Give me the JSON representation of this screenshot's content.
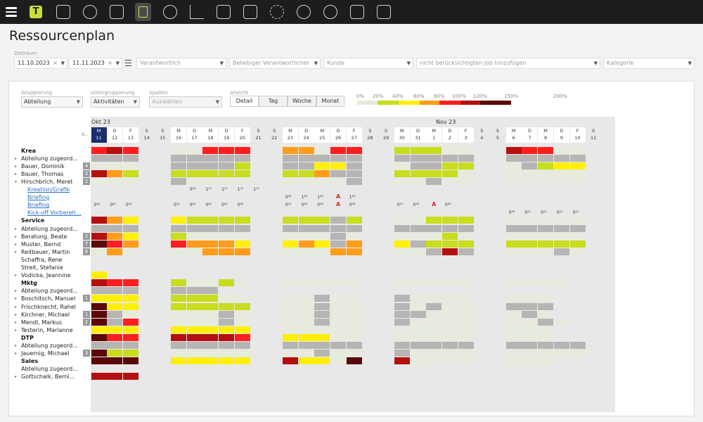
{
  "app": {
    "page_title": "Ressourcenplan"
  },
  "topbar": {
    "logo_letter": "T",
    "icons": [
      "menu-icon",
      "timesheet-icon",
      "location-icon",
      "files-icon",
      "plan-icon",
      "clock-icon",
      "chart-icon",
      "cart-icon",
      "documents-icon",
      "gear-icon",
      "sync-icon",
      "people-icon",
      "megaphone-icon",
      "chat-icon"
    ]
  },
  "filters": {
    "zeitraum_label": "Zeitraum",
    "from_date": "11.10.2023",
    "to_date": "11.11.2023",
    "verantwortlich": "Verantwortlich",
    "beliebiger": "Beliebiger Verantwortlicher",
    "kunde": "Kunde",
    "job": "nicht berücksichtigten Job hinzufügen",
    "kategorie": "Kategorie"
  },
  "controls": {
    "gruppierung_label": "Gruppierung",
    "gruppierung_value": "Abteilung",
    "untergruppierung_label": "Untergruppierung",
    "untergruppierung_value": "Aktivitäten",
    "spalten_label": "Spalten",
    "spalten_value": "Auswählen",
    "ansicht_label": "Ansicht",
    "views": [
      "Detail",
      "Tag",
      "Woche",
      "Monat"
    ],
    "active_view": "Detail"
  },
  "legend": {
    "labels": [
      "0%",
      "20%",
      "40%",
      "60%",
      "80%",
      "100%",
      "120%",
      "150%",
      "200%"
    ],
    "colors": [
      "#e6ebdd",
      "#c7dd1d",
      "#ffef00",
      "#ff9d19",
      "#ff1e1e",
      "#b51010",
      "#5a0808"
    ]
  },
  "colors": {
    "today": "#1c2e6e",
    "absence": "#e02020"
  },
  "calendar": {
    "months": [
      "Okt 23",
      "Nov 23"
    ],
    "axis_prefix": "A...",
    "days": [
      {
        "wd": "M",
        "d": "11"
      },
      {
        "wd": "D",
        "d": "12"
      },
      {
        "wd": "F",
        "d": "13"
      },
      {
        "wd": "S",
        "d": "14"
      },
      {
        "wd": "S",
        "d": "15"
      },
      {
        "wd": "M",
        "d": "16"
      },
      {
        "wd": "D",
        "d": "17"
      },
      {
        "wd": "M",
        "d": "18"
      },
      {
        "wd": "D",
        "d": "19"
      },
      {
        "wd": "F",
        "d": "20"
      },
      {
        "wd": "S",
        "d": "21"
      },
      {
        "wd": "S",
        "d": "22"
      },
      {
        "wd": "M",
        "d": "23"
      },
      {
        "wd": "D",
        "d": "24"
      },
      {
        "wd": "M",
        "d": "25"
      },
      {
        "wd": "D",
        "d": "26"
      },
      {
        "wd": "F",
        "d": "27"
      },
      {
        "wd": "S",
        "d": "28"
      },
      {
        "wd": "S",
        "d": "29"
      },
      {
        "wd": "M",
        "d": "30"
      },
      {
        "wd": "D",
        "d": "31"
      },
      {
        "wd": "M",
        "d": "1"
      },
      {
        "wd": "D",
        "d": "2"
      },
      {
        "wd": "F",
        "d": "3"
      },
      {
        "wd": "S",
        "d": "4"
      },
      {
        "wd": "S",
        "d": "5"
      },
      {
        "wd": "M",
        "d": "6"
      },
      {
        "wd": "D",
        "d": "7"
      },
      {
        "wd": "M",
        "d": "8"
      },
      {
        "wd": "D",
        "d": "9"
      },
      {
        "wd": "F",
        "d": "10"
      },
      {
        "wd": "S",
        "d": "11"
      }
    ]
  },
  "rows": [
    {
      "type": "group",
      "label": "Krea",
      "cells": "5656500555544405500222000665500222222"
    },
    {
      "type": "person",
      "label": "Abteilung zugeord...",
      "expand": "▸",
      "cells": "XXX00XXXXX00XXXXX00XXXXX00XXXXX0"
    },
    {
      "type": "person",
      "label": "Bauer, Dominik",
      "badge": "4",
      "expand": "▸",
      "cells": "00000XXXX200XX33X200XX22200X2332"
    },
    {
      "type": "person",
      "label": "Bauer, Thomas",
      "badge": "2",
      "expand": "▸",
      "cells": "642002222200224XX00222200000000"
    },
    {
      "type": "person",
      "label": "Hirschbrich, Meret",
      "badge": "2",
      "expand": "▾",
      "cells": "11100X1111001111X1001X11110011111"
    },
    {
      "type": "task",
      "label": "Kreation/Grafik",
      "loads": [
        [
          6,
          "0⁵³"
        ],
        [
          7,
          "1⁴⁷"
        ],
        [
          8,
          "1⁴⁷"
        ],
        [
          9,
          "1⁴⁷"
        ],
        [
          10,
          "1⁴⁷"
        ]
      ]
    },
    {
      "type": "task",
      "label": "Briefing",
      "loads": [
        [
          12,
          "0⁴³"
        ],
        [
          13,
          "1²⁵"
        ],
        [
          14,
          "1²⁵"
        ],
        [
          15,
          "A"
        ],
        [
          16,
          "1²⁵"
        ]
      ]
    },
    {
      "type": "task",
      "label": "Briefing",
      "loads": [
        [
          0,
          "0²²"
        ],
        [
          1,
          "0²²"
        ],
        [
          2,
          "0²²"
        ],
        [
          5,
          "0¹¹"
        ],
        [
          6,
          "0²²"
        ],
        [
          7,
          "0²²"
        ],
        [
          8,
          "0²²"
        ],
        [
          9,
          "0²²"
        ],
        [
          12,
          "0¹¹"
        ],
        [
          13,
          "0²²"
        ],
        [
          14,
          "0²²"
        ],
        [
          15,
          "A"
        ],
        [
          16,
          "0²²"
        ],
        [
          19,
          "0¹¹"
        ],
        [
          20,
          "0²²"
        ],
        [
          21,
          "A"
        ],
        [
          22,
          "0²²"
        ]
      ]
    },
    {
      "type": "task",
      "label": "Kick-off Vorbereit...",
      "loads": [
        [
          26,
          "0⁰⁶"
        ],
        [
          27,
          "0¹¹"
        ],
        [
          28,
          "0¹¹"
        ],
        [
          29,
          "0¹¹"
        ],
        [
          30,
          "0¹¹"
        ]
      ]
    },
    {
      "type": "group",
      "label": "Service",
      "cells": "643003222200222X2001122200000000"
    },
    {
      "type": "person",
      "label": "Abteilung zugeord...",
      "expand": "▸",
      "cells": "XXX00XXXXX00XXXXX00XXXXX00XXXXX0"
    },
    {
      "type": "person",
      "label": "Beratung, Beate",
      "badge": "2",
      "expand": "▸",
      "cells": "643002000000000X000000200000000"
    },
    {
      "type": "person",
      "label": "Muster, Bernd",
      "badge": "7",
      "expand": "▸",
      "cells": "754005444300343X4003X22200222222"
    },
    {
      "type": "person",
      "label": "Reitbauer, Martin",
      "badge": "6",
      "expand": "▸",
      "cells": "141000044444001444X00X6X44000X0000X"
    },
    {
      "type": "person",
      "label": "Schaffra, Rene",
      "cells": ""
    },
    {
      "type": "person",
      "label": "Streit, Stefanie",
      "cells": ""
    },
    {
      "type": "person",
      "label": "Vodicka, Jeannine",
      "expand": "▸",
      "cells": "3"
    },
    {
      "type": "group",
      "label": "Mktg",
      "cells": "655002002000000000000000000000"
    },
    {
      "type": "person",
      "label": "Abteilung zugeord...",
      "expand": "▸",
      "cells": "XXX00XXX"
    },
    {
      "type": "person",
      "label": "Boschitsch, Manuel",
      "badge": "1",
      "expand": "▸",
      "cells": "33300222000000X0000X000000000"
    },
    {
      "type": "person",
      "label": "Frischknecht, Rahel",
      "expand": "▸",
      "cells": "73300222220000X0000X0X00XXXXX"
    },
    {
      "type": "person",
      "label": "Kirchner, Michael",
      "badge": "1",
      "expand": "▸",
      "cells": "7X000000X00000X0000XX000000X0"
    },
    {
      "type": "person",
      "label": "Mendl, Markus",
      "badge": "2",
      "expand": "▸",
      "cells": "7X500000X00000X0000X00000000X0"
    },
    {
      "type": "person",
      "label": "Testerin, Marianne",
      "expand": "▸",
      "cells": "33300333330000000000000000000"
    },
    {
      "type": "group",
      "label": "DTP",
      "cells": "75500666650033300000000000000"
    },
    {
      "type": "person",
      "label": "Abteilung zugeord...",
      "expand": "▸",
      "cells": "XXX00XXXXX00XXXXX00XXXXX00XXXXX0"
    },
    {
      "type": "person",
      "label": "Jauernig, Michael",
      "badge": "3",
      "expand": "▸",
      "cells": "72200000000000X0000X00000000000"
    },
    {
      "type": "group",
      "label": "Sales",
      "cells": "77700333330063307006000000000"
    },
    {
      "type": "person",
      "label": "Abteilung zugeord...",
      "cells": ""
    },
    {
      "type": "person",
      "label": "Gottschalk, Berni...",
      "expand": "▸",
      "cells": "66600"
    }
  ]
}
